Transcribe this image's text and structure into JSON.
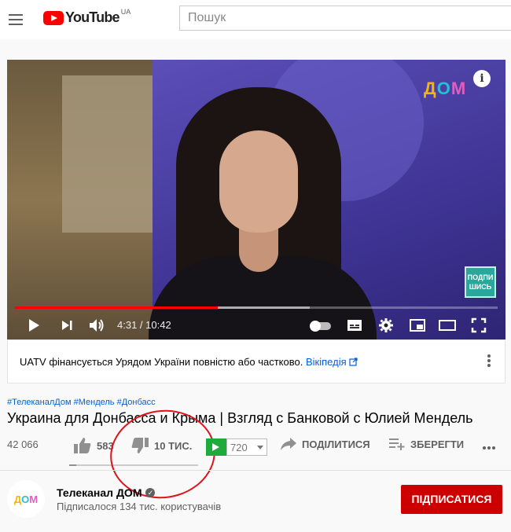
{
  "header": {
    "logo_text": "YouTube",
    "region": "UA",
    "search_placeholder": "Пошук"
  },
  "player": {
    "channel_watermark": [
      "Д",
      "О",
      "М"
    ],
    "subscribe_badge": "ПОДПИ ШИСЬ",
    "time_current": "4:31",
    "time_total": "10:42",
    "time_display": "4:31 / 10:42",
    "progress_played_fraction": 0.421,
    "progress_buffered_fraction": 0.61
  },
  "info_panel": {
    "text": "UATV фінансується Урядом України повністю або частково.",
    "link": "Вікіпедія"
  },
  "video": {
    "hashtags": "#ТелеканалДом #Мендель #Донбасс",
    "title": "Украина для Донбасса и Крыма | Взгляд с Банковой с Юлией Мендель",
    "views": "42 066",
    "likes": "583",
    "dislikes": "10 ТИС.",
    "quality": "720",
    "share_label": "ПОДІЛИТИСЯ",
    "save_label": "ЗБЕРЕГТИ",
    "sentiment_like_fraction": 0.055
  },
  "channel": {
    "name": "Телеканал ДОМ",
    "subscribers": "Підписалося 134 тис. користувачів",
    "avatar_letters": [
      "Д",
      "О",
      "М"
    ],
    "subscribe_label": "ПІДПИСАТИСЯ"
  },
  "colors": {
    "accent_red": "#ff0000",
    "subscribe_red": "#cc0000",
    "link_blue": "#065fd4",
    "annotation_red": "#e0121b"
  }
}
